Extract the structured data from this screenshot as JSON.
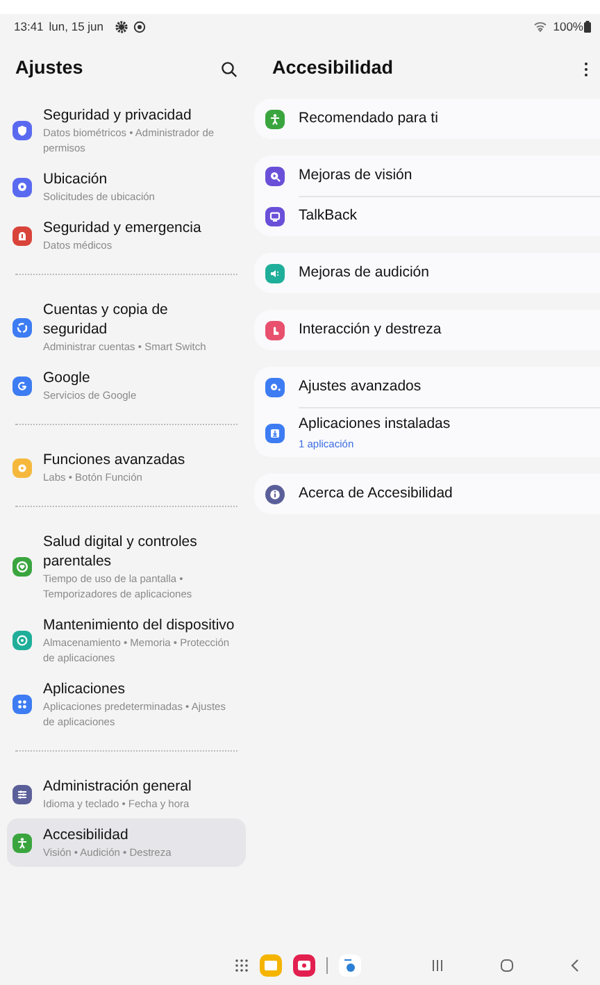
{
  "status_bar": {
    "time": "13:41",
    "date": "lun, 15 jun",
    "battery": "100%"
  },
  "settings": {
    "title": "Ajustes",
    "groups": [
      [
        {
          "title": "Seguridad y privacidad",
          "subtitle": "Datos biométricos • Administrador de permisos",
          "color": "#5a6af0",
          "selected": false
        },
        {
          "title": "Ubicación",
          "subtitle": "Solicitudes de ubicación",
          "color": "#5a6af0",
          "selected": false
        },
        {
          "title": "Seguridad y emergencia",
          "subtitle": "Datos médicos",
          "color": "#d9443a",
          "selected": false
        }
      ],
      [
        {
          "title": "Cuentas y copia de seguridad",
          "subtitle": "Administrar cuentas • Smart Switch",
          "color": "#3d7cf2",
          "selected": false
        },
        {
          "title": "Google",
          "subtitle": "Servicios de Google",
          "color": "#3d7cf2",
          "selected": false
        }
      ],
      [
        {
          "title": "Funciones avanzadas",
          "subtitle": "Labs • Botón Función",
          "color": "#f5b83d",
          "selected": false
        }
      ],
      [
        {
          "title": "Salud digital y controles parentales",
          "subtitle": "Tiempo de uso de la pantalla • Temporizadores de aplicaciones",
          "color": "#3aa53f",
          "selected": false
        },
        {
          "title": "Mantenimiento del dispositivo",
          "subtitle": "Almacenamiento • Memoria • Protección de aplicaciones",
          "color": "#1fae9a",
          "selected": false
        },
        {
          "title": "Aplicaciones",
          "subtitle": "Aplicaciones predeterminadas • Ajustes de aplicaciones",
          "color": "#3d7cf2",
          "selected": false
        }
      ],
      [
        {
          "title": "Administración general",
          "subtitle": "Idioma y teclado • Fecha y hora",
          "color": "#5b5f99",
          "selected": false
        },
        {
          "title": "Accesibilidad",
          "subtitle": "Visión • Audición • Destreza",
          "color": "#3aa53f",
          "selected": true
        }
      ]
    ]
  },
  "detail": {
    "title": "Accesibilidad",
    "cards": [
      [
        {
          "title": "Recomendado para ti",
          "color": "#3aa53f"
        }
      ],
      [
        {
          "title": "Mejoras de visión",
          "color": "#6a4fd8"
        },
        {
          "title": "TalkBack",
          "color": "#6a4fd8"
        }
      ],
      [
        {
          "title": "Mejoras de audición",
          "color": "#1fae9a"
        }
      ],
      [
        {
          "title": "Interacción y destreza",
          "color": "#e8506e"
        }
      ],
      [
        {
          "title": "Ajustes avanzados",
          "color": "#3d7cf2"
        },
        {
          "title": "Aplicaciones instaladas",
          "subtitle": "1 aplicación",
          "color": "#3d7cf2"
        }
      ],
      [
        {
          "title": "Acerca de Accesibilidad",
          "color": "#5b5f99"
        }
      ]
    ]
  }
}
